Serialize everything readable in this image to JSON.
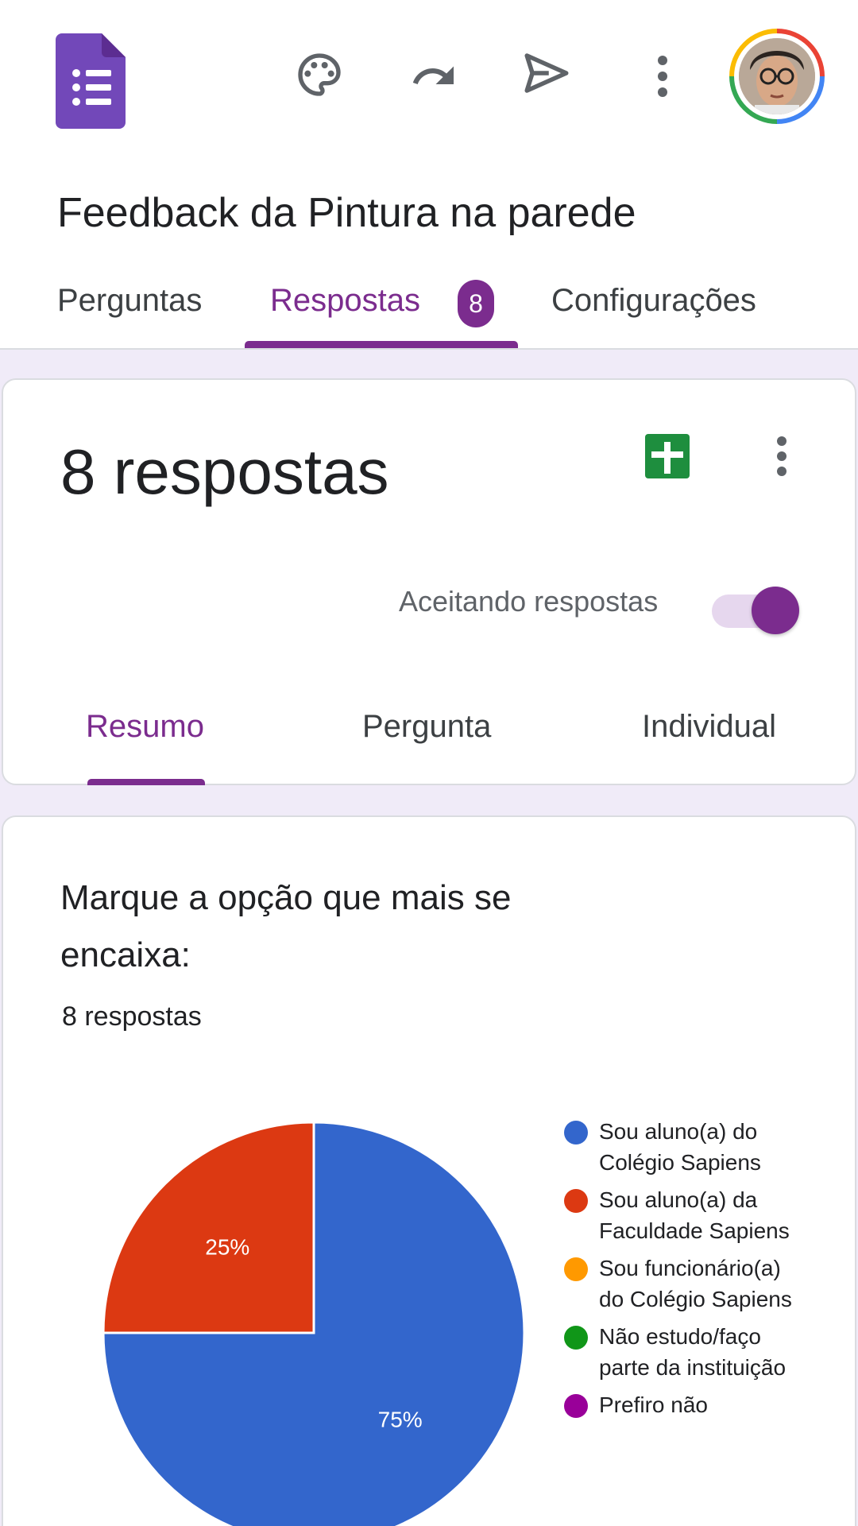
{
  "header": {
    "form_title": "Feedback da Pintura na parede",
    "icons": [
      "forms-logo-icon",
      "palette-icon",
      "undo-icon",
      "send-icon",
      "more-vert-icon",
      "avatar"
    ]
  },
  "tabs": [
    {
      "label": "Perguntas"
    },
    {
      "label": "Respostas",
      "badge": "8",
      "active": true
    },
    {
      "label": "Configurações"
    }
  ],
  "summary_card": {
    "responses_title": "8 respostas",
    "accepting_label": "Aceitando respostas",
    "accepting_on": true,
    "subtabs": [
      {
        "label": "Resumo",
        "active": true
      },
      {
        "label": "Pergunta"
      },
      {
        "label": "Individual"
      }
    ]
  },
  "question_card": {
    "title": "Marque a opção que mais se encaixa:",
    "count": "8 respostas"
  },
  "colors": {
    "accent": "#7b2c8e",
    "background": "#f0ebf8",
    "sheets_green": "#1e8e3e"
  },
  "chart_data": {
    "type": "pie",
    "slices": [
      {
        "label": "Sou aluno(a) do Colégio Sapiens",
        "value": 75,
        "display": "75%",
        "color": "#3366cc"
      },
      {
        "label": "Sou aluno(a) da Faculdade Sapiens",
        "value": 25,
        "display": "25%",
        "color": "#dc3912"
      },
      {
        "label": "Sou funcionário(a) do Colégio Sapiens",
        "value": 0,
        "display": "",
        "color": "#ff9900"
      },
      {
        "label": "Não estudo/faço parte da instituição",
        "value": 0,
        "display": "",
        "color": "#109618"
      },
      {
        "label": "Prefiro não",
        "value": 0,
        "display": "",
        "color": "#990099"
      }
    ],
    "legend_placement": "right"
  }
}
